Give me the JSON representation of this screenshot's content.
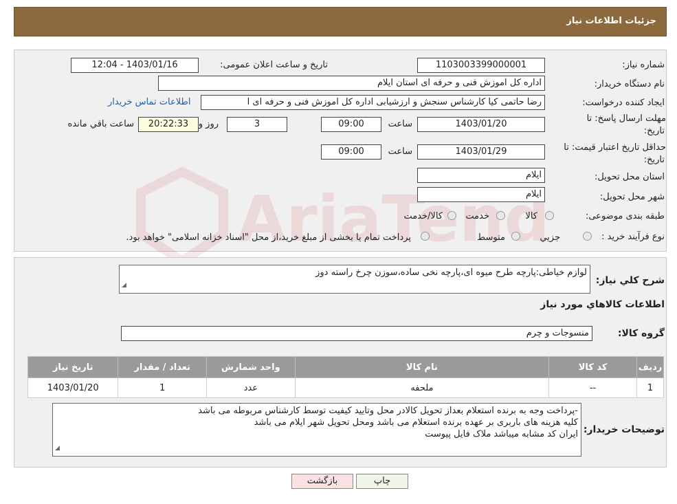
{
  "header": {
    "title": "جزئیات اطلاعات نیاز"
  },
  "form": {
    "need_number_label": "شماره نیاز:",
    "need_number": "1103003399000001",
    "announce_label": "تاریخ و ساعت اعلان عمومی:",
    "announce_value": "1403/01/16 - 12:04",
    "buyer_label": "نام دستگاه خریدار:",
    "buyer_value": "اداره کل اموزش فنی و حرفه ای استان ایلام",
    "creator_label": "ایجاد کننده درخواست:",
    "creator_value": "رضا حاتمی کیا کارشناس سنجش و ارزشیابی اداره کل اموزش فنی و حرفه ای ا",
    "contact_link": "اطلاعات تماس خریدار",
    "deadline_label_1": "مهلت ارسال پاسخ: تا",
    "deadline_label_2": "تاریخ:",
    "deadline_date": "1403/01/20",
    "time_label": "ساعت",
    "deadline_time": "09:00",
    "days_value": "3",
    "days_label": "روز و",
    "remaining_time": "20:22:33",
    "remaining_label": "ساعت باقي مانده",
    "validity_label_1": "حداقل تاریخ اعتبار قیمت: تا",
    "validity_label_2": "تاریخ:",
    "validity_date": "1403/01/29",
    "validity_time": "09:00",
    "province_label": "استان محل تحویل:",
    "province_value": "ایلام",
    "city_label": "شهر محل تحویل:",
    "city_value": "ایلام",
    "category_label": "طبقه بندی موضوعی:",
    "category_options": [
      "کالا",
      "خدمت",
      "کالا/خدمت"
    ],
    "process_label": "نوع فرآیند خرید :",
    "process_options": [
      "جزیي",
      "متوسط"
    ],
    "payment_note": "پرداخت تمام یا بخشی از مبلغ خرید،از محل \"اسناد خزانه اسلامی\" خواهد بود."
  },
  "details": {
    "summary_label": "شرح كلي نياز:",
    "summary_value": "لوازم خیاطی:پارچه طرح میوه ای،پارچه نخی ساده،سوزن چرخ راسته دوز",
    "goods_info_title": "اطلاعات كالاهاي مورد نياز",
    "goods_group_label": "گروه کالا:",
    "goods_group_value": "منسوجات و چرم",
    "table": {
      "headers": [
        "رديف",
        "كد كالا",
        "نام كالا",
        "واحد شمارش",
        "تعداد / مقدار",
        "تاريخ نياز"
      ],
      "rows": [
        [
          "1",
          "--",
          "ملحفه",
          "عدد",
          "1",
          "1403/01/20"
        ]
      ]
    },
    "buyer_notes_label": "توضیحات خریدار:",
    "buyer_notes": [
      "-پرداخت وجه به برنده استعلام بعداز تحویل کالادر محل وتایید کیفیت توسط کارشناس مربوطه می باشد",
      "کلیه هزینه های باربری بر عهده برنده  استعلام می باشد ومحل تحویل شهر ایلام می باشد",
      "ایران کد مشابه میباشد ملاک فایل پیوست"
    ]
  },
  "buttons": {
    "print": "چاپ",
    "back": "بازگشت"
  },
  "watermark": {
    "text": "AriaTender.neT"
  }
}
